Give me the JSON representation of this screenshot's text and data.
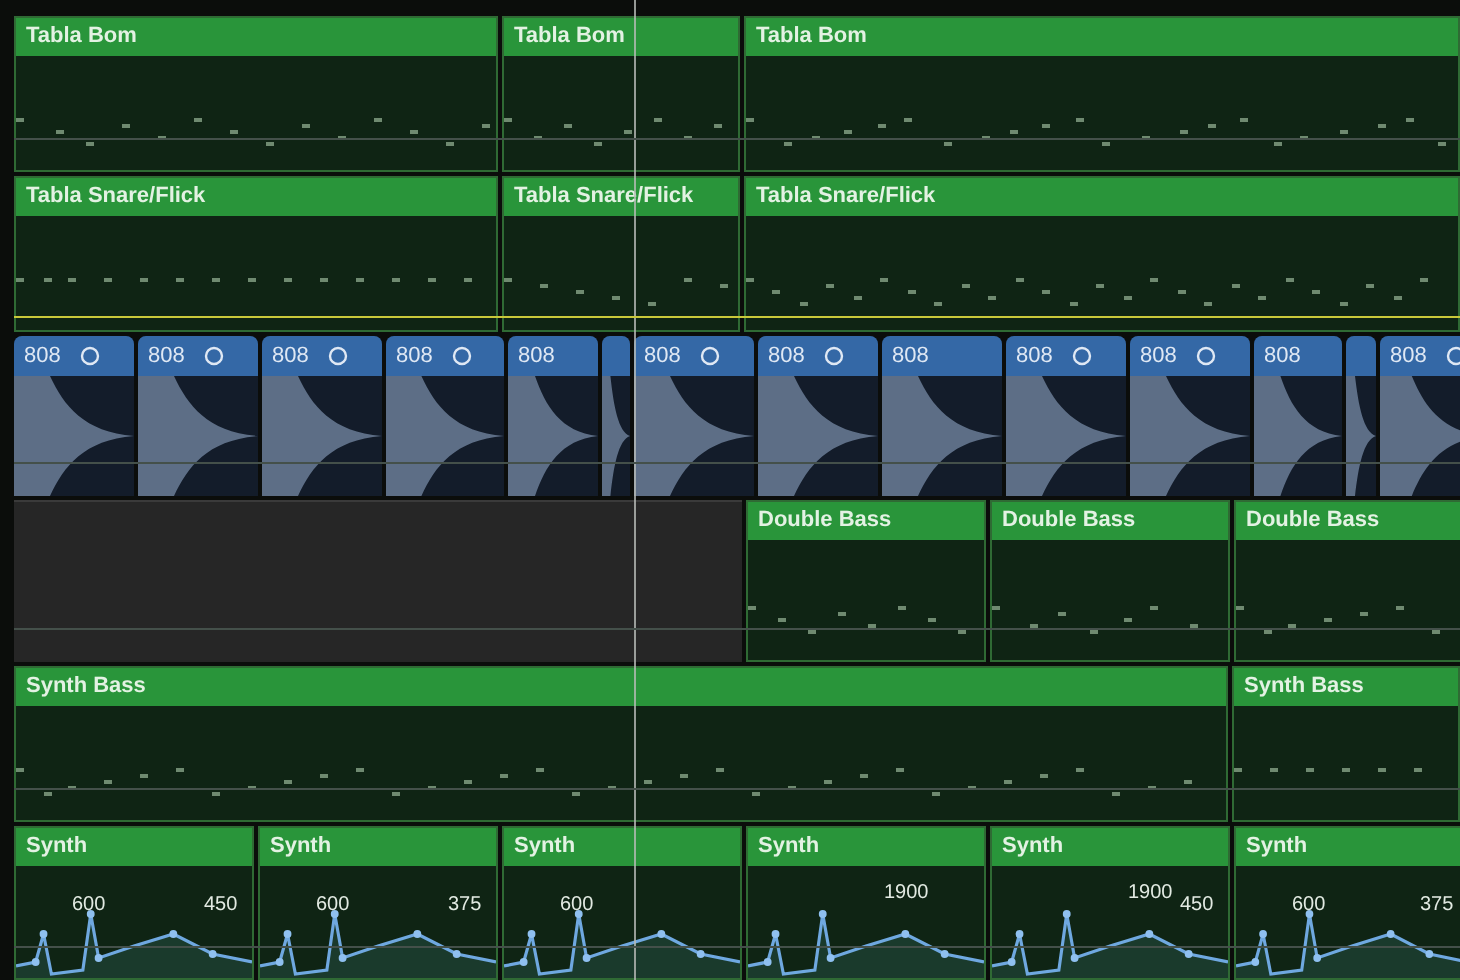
{
  "tracks": [
    {
      "kind": "notes",
      "selected": false,
      "regions": [
        {
          "label": "Tabla Bom"
        },
        {
          "label": "Tabla Bom"
        },
        {
          "label": "Tabla Bom"
        }
      ]
    },
    {
      "kind": "notes",
      "selected": true,
      "regions": [
        {
          "label": "Tabla Snare/Flick"
        },
        {
          "label": "Tabla Snare/Flick"
        },
        {
          "label": "Tabla Snare/Flick"
        }
      ]
    },
    {
      "kind": "drum",
      "selected": false,
      "regions": [
        {
          "label": "808",
          "loop": true
        },
        {
          "label": "808",
          "loop": true
        },
        {
          "label": "808",
          "loop": true
        },
        {
          "label": "808",
          "loop": true
        },
        {
          "label": "808",
          "loop": false
        },
        {
          "kind": "sliver"
        },
        {
          "label": "808",
          "loop": true
        },
        {
          "label": "808",
          "loop": true
        },
        {
          "label": "808",
          "loop": false
        },
        {
          "label": "808",
          "loop": true
        },
        {
          "label": "808",
          "loop": true
        },
        {
          "label": "808",
          "loop": false
        },
        {
          "kind": "sliver"
        },
        {
          "label": "808",
          "loop": true
        }
      ]
    },
    {
      "kind": "notes",
      "selected": false,
      "regions": [
        {
          "kind": "empty"
        },
        {
          "label": "Double Bass"
        },
        {
          "label": "Double Bass"
        },
        {
          "label": "Double Bass"
        }
      ]
    },
    {
      "kind": "notes",
      "selected": false,
      "regions": [
        {
          "label": "Synth Bass"
        },
        {
          "label": "Synth Bass"
        }
      ]
    },
    {
      "kind": "automation",
      "selected": false,
      "regions": [
        {
          "label": "Synth",
          "values": [
            "600",
            "450"
          ]
        },
        {
          "label": "Synth",
          "values": [
            "600",
            "375"
          ]
        },
        {
          "label": "Synth",
          "values": [
            "600"
          ]
        },
        {
          "label": "Synth",
          "values": [
            "1900"
          ]
        },
        {
          "label": "Synth",
          "values": [
            "1900",
            "450"
          ]
        },
        {
          "label": "Synth",
          "values": [
            "600",
            "375"
          ]
        }
      ]
    }
  ]
}
